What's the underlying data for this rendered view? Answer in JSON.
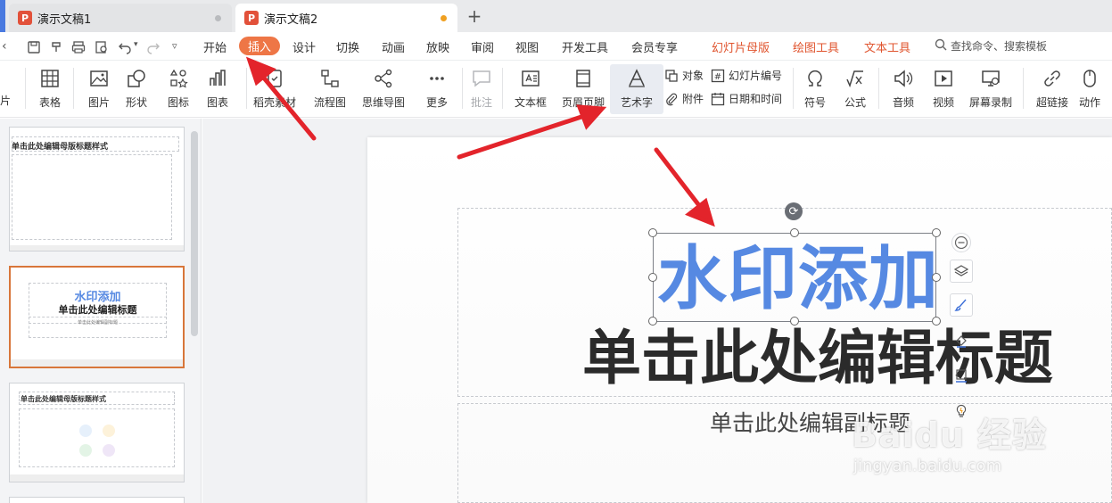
{
  "tabs": [
    {
      "title": "演示文稿1",
      "modified": false
    },
    {
      "title": "演示文稿2",
      "modified": true
    }
  ],
  "menu": {
    "items": [
      "开始",
      "插入",
      "设计",
      "切换",
      "动画",
      "放映",
      "审阅",
      "视图",
      "开发工具",
      "会员专享"
    ],
    "active": "插入",
    "context_items": [
      "幻灯片母版",
      "绘图工具",
      "文本工具"
    ],
    "search": "查找命令、搜索模板"
  },
  "ribbon": {
    "partial_left": "片",
    "table": "表格",
    "picture": "图片",
    "shape": "形状",
    "icon": "图标",
    "chart": "图表",
    "material": "稻壳素材",
    "flowchart": "流程图",
    "mindmap": "思维导图",
    "more": "更多",
    "comment": "批注",
    "textbox": "文本框",
    "header_footer": "页眉页脚",
    "wordart": "艺术字",
    "object": "对象",
    "slide_number": "幻灯片编号",
    "attachment": "附件",
    "datetime": "日期和时间",
    "symbol": "符号",
    "formula": "公式",
    "audio": "音频",
    "video": "视频",
    "screen_record": "屏幕录制",
    "hyperlink": "超链接",
    "action": "动作"
  },
  "thumbnails": {
    "master_title": "单击此处编辑母版标题样式",
    "layout_wordart": "水印添加",
    "layout_title": "单击此处编辑标题",
    "layout_sub": "单击此处编辑副标题",
    "layout3_title": "单击此处编辑母版标题样式"
  },
  "slide": {
    "wordart": "水印添加",
    "title": "单击此处编辑标题",
    "subtitle": "单击此处编辑副标题"
  },
  "watermark": {
    "logo": "Baidu 经验",
    "url": "jingyan.baidu.com"
  },
  "colors": {
    "accent": "#ee7646",
    "context": "#e0542e",
    "wordart": "#5689e2",
    "arrow": "#e3242b"
  }
}
